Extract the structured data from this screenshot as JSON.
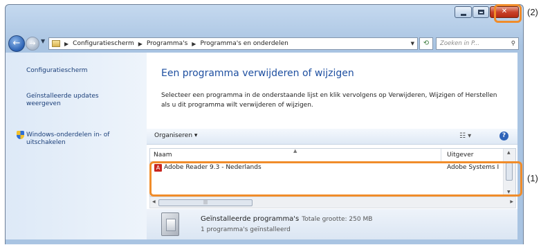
{
  "address_bar": {
    "crumbs": [
      "Configuratiescherm",
      "Programma's",
      "Programma's en onderdelen"
    ],
    "search_placeholder": "Zoeken in P..."
  },
  "sidebar": {
    "items": [
      {
        "label": "Configuratiescherm"
      },
      {
        "label": "Geïnstalleerde updates weergeven"
      },
      {
        "label": "Windows-onderdelen in- of uitschakelen",
        "icon": "shield-icon"
      }
    ]
  },
  "main": {
    "title": "Een programma verwijderen of wijzigen",
    "description": "Selecteer een programma in de onderstaande lijst en klik vervolgens op Verwijderen, Wijzigen of Herstellen als u dit programma wilt verwijderen of wijzigen."
  },
  "toolbar": {
    "organize_label": "Organiseren ▾"
  },
  "program_list": {
    "columns": [
      "Naam",
      "Uitgever"
    ],
    "rows": [
      {
        "name": "Adobe Reader 9.3 - Nederlands",
        "publisher": "Adobe Systems I"
      }
    ]
  },
  "details": {
    "title": "Geïnstalleerde programma's",
    "total_size": "Totale grootte: 250 MB",
    "count": "1 programma's geïnstalleerd"
  },
  "callouts": {
    "close_label": "(2)",
    "list_label": "(1)",
    "color": "#f08c2a"
  }
}
